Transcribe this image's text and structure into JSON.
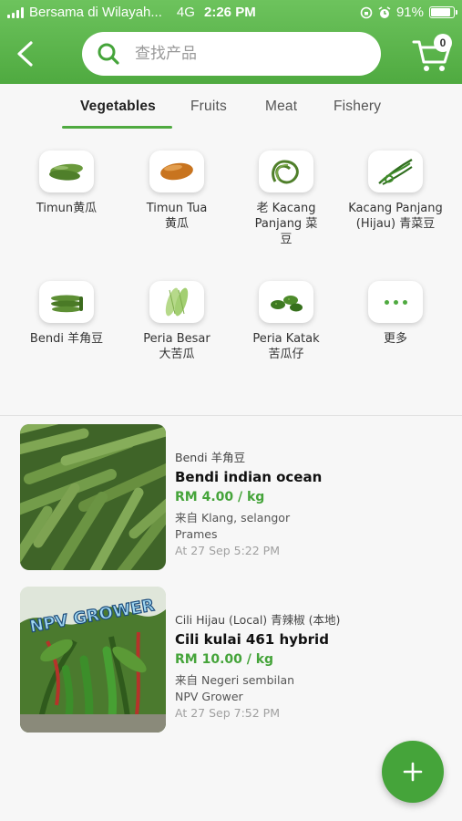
{
  "status_bar": {
    "carrier": "Bersama di Wilayah...",
    "network": "4G",
    "time": "2:26 PM",
    "battery": "91%",
    "battery_level": 0.91,
    "signal_bars": 4
  },
  "header": {
    "search_placeholder": "查找产品",
    "cart_count": "0",
    "back_icon": "chevron-left-icon",
    "cart_icon": "cart-icon",
    "search_icon": "search-icon"
  },
  "tabs": [
    {
      "label": "Vegetables",
      "active": true
    },
    {
      "label": "Fruits",
      "active": false
    },
    {
      "label": "Meat",
      "active": false
    },
    {
      "label": "Fishery",
      "active": false
    }
  ],
  "categories": [
    {
      "label": "Timun黄瓜"
    },
    {
      "label": "Timun Tua\n黄瓜"
    },
    {
      "label": "老 Kacang Panjang  菜\n豆"
    },
    {
      "label": "Kacang Panjang\n(Hijau) 青菜豆"
    },
    {
      "label": "Bendi 羊角豆"
    },
    {
      "label": "Peria Besar\n大苦瓜"
    },
    {
      "label": "Peria Katak\n苦瓜仔"
    },
    {
      "label": "更多"
    }
  ],
  "listings": [
    {
      "category": "Bendi 羊角豆",
      "title": "Bendi indian ocean",
      "price": "RM 4.00 / kg",
      "location": "来自 Klang, selangor",
      "seller": "Prames",
      "date": "At 27 Sep 5:22 PM"
    },
    {
      "category": "Cili Hijau (Local) 青辣椒 (本地)",
      "title": "Cili kulai 461 hybrid",
      "price": "RM 10.00 / kg",
      "location": "来自 Negeri sembilan",
      "seller": "NPV Grower",
      "date": "At 27 Sep 7:52 PM",
      "watermark": "NPV GROWER"
    }
  ],
  "colors": {
    "accent": "#4faa40",
    "price": "#45a43a"
  }
}
